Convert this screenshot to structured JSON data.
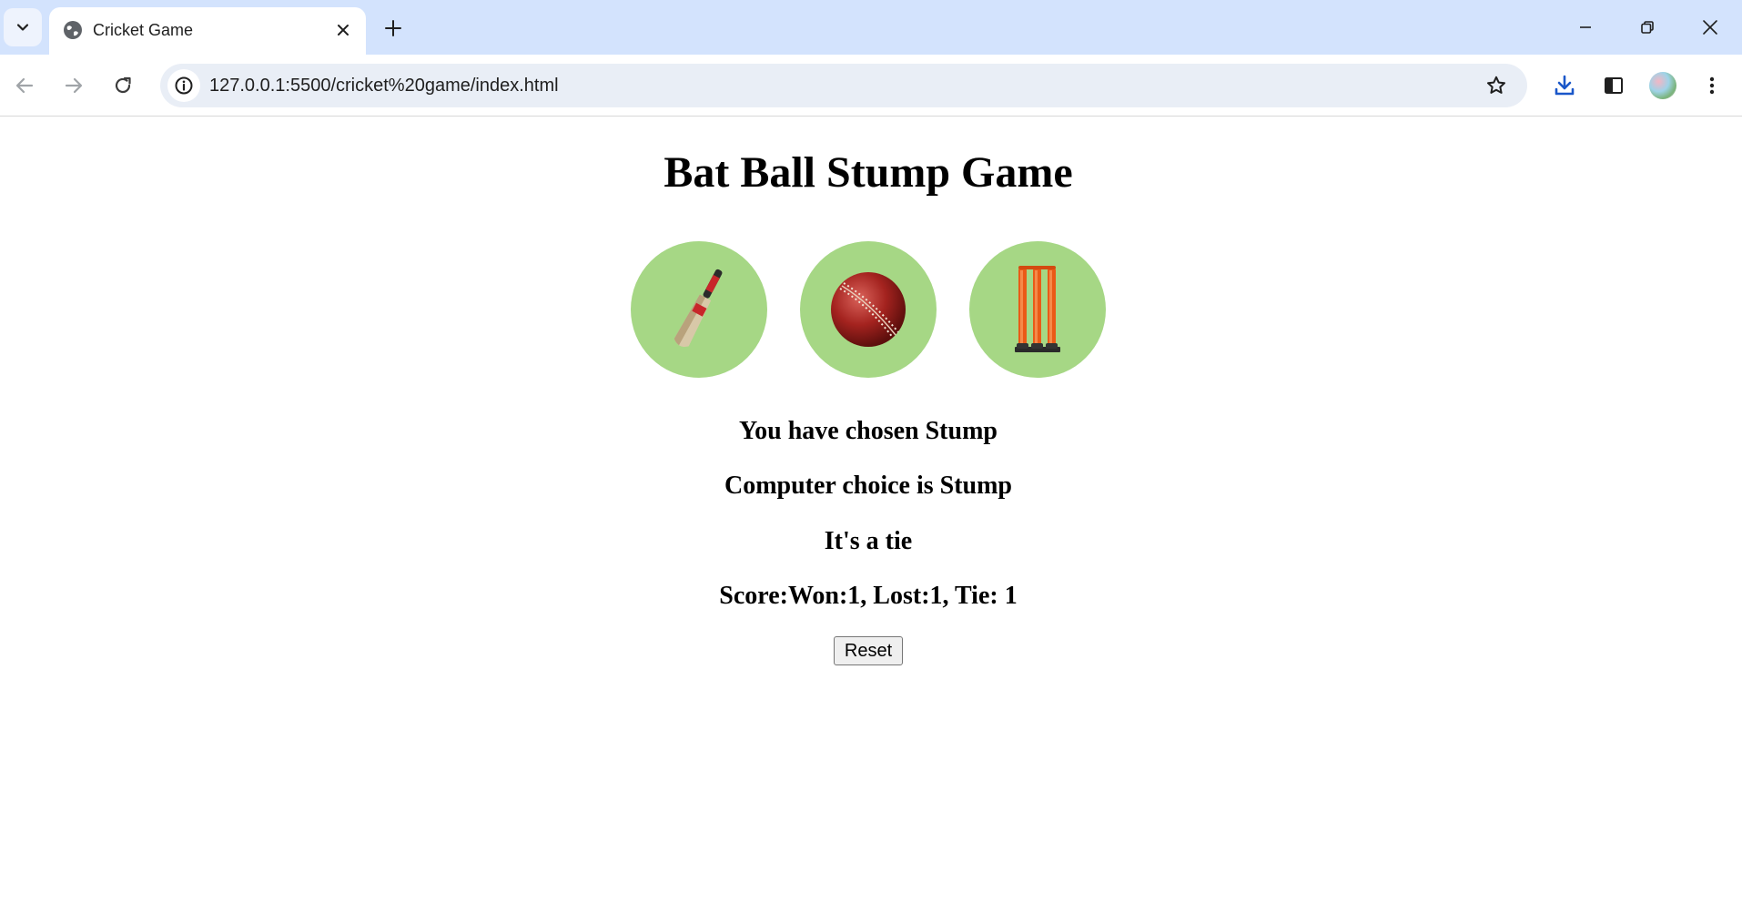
{
  "browser": {
    "tab_title": "Cricket Game",
    "url": "127.0.0.1:5500/cricket%20game/index.html"
  },
  "page": {
    "title": "Bat Ball Stump Game",
    "choices": [
      {
        "name": "Bat",
        "icon": "cricket-bat-icon"
      },
      {
        "name": "Ball",
        "icon": "cricket-ball-icon"
      },
      {
        "name": "Stump",
        "icon": "cricket-stumps-icon"
      }
    ],
    "user_choice_text": "You have chosen Stump",
    "computer_choice_text": "Computer choice is Stump",
    "result_text": "It's a tie",
    "score_text": "Score:Won:1, Lost:1, Tie: 1",
    "reset_label": "Reset",
    "choice_bg_color": "#a6d785"
  }
}
